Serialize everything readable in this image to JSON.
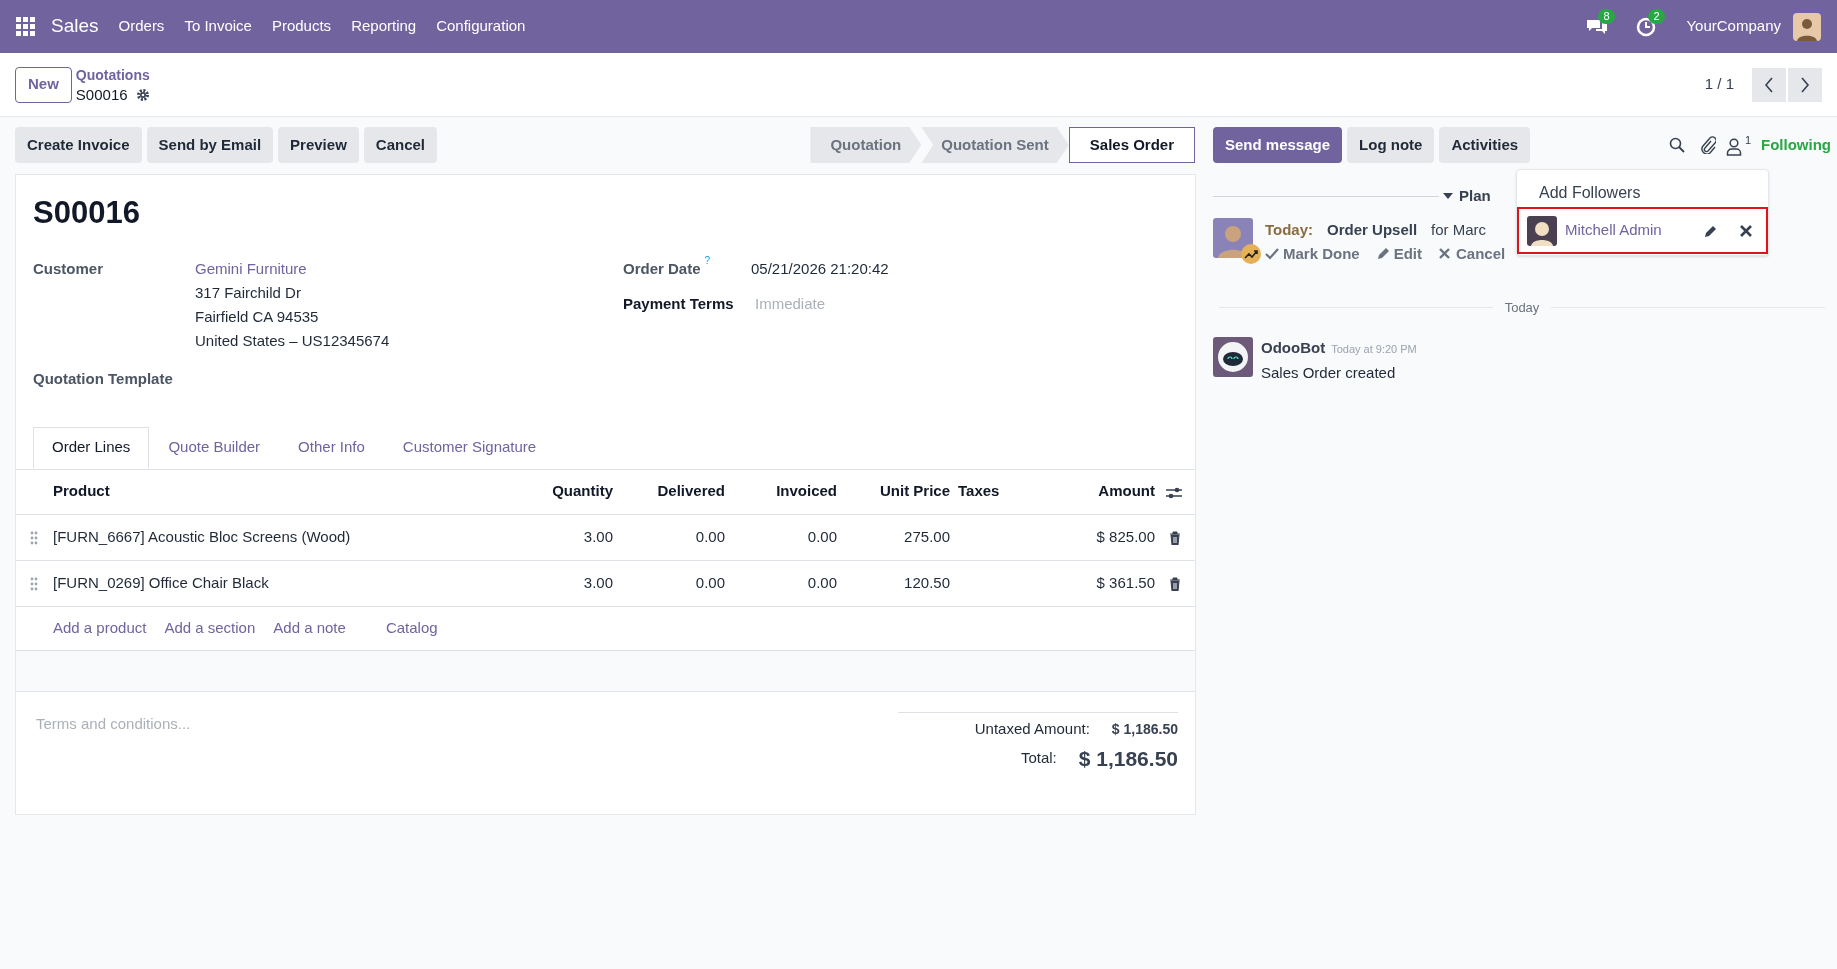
{
  "navbar": {
    "app": "Sales",
    "menu": [
      "Orders",
      "To Invoice",
      "Products",
      "Reporting",
      "Configuration"
    ],
    "messages_badge": "8",
    "activities_badge": "2",
    "company": "YourCompany"
  },
  "control_panel": {
    "new_button": "New",
    "breadcrumb": "Quotations",
    "record": "S00016",
    "pager": "1 / 1"
  },
  "actions": [
    "Create Invoice",
    "Send by Email",
    "Preview",
    "Cancel"
  ],
  "statusbar": [
    {
      "label": "Quotation",
      "selected": false
    },
    {
      "label": "Quotation Sent",
      "selected": false
    },
    {
      "label": "Sales Order",
      "selected": true
    }
  ],
  "form": {
    "title": "S00016",
    "customer": {
      "label": "Customer",
      "name": "Gemini Furniture",
      "address": [
        "317 Fairchild Dr",
        "Fairfield CA 94535",
        "United States – US12345674"
      ]
    },
    "quotation_template": {
      "label": "Quotation Template"
    },
    "order_date": {
      "label": "Order Date",
      "help": "?",
      "value": "05/21/2026 21:20:42"
    },
    "payment_terms": {
      "label": "Payment Terms",
      "placeholder": "Immediate"
    },
    "tabs": [
      {
        "label": "Order Lines",
        "selected": true
      },
      {
        "label": "Quote Builder",
        "selected": false
      },
      {
        "label": "Other Info",
        "selected": false
      },
      {
        "label": "Customer Signature",
        "selected": false
      }
    ],
    "table": {
      "columns": [
        "Product",
        "Quantity",
        "Delivered",
        "Invoiced",
        "Unit Price",
        "Taxes",
        "Amount"
      ],
      "rows": [
        [
          "[FURN_6667] Acoustic Bloc Screens (Wood)",
          "3.00",
          "0.00",
          "0.00",
          "275.00",
          "",
          "$ 825.00"
        ],
        [
          "[FURN_0269] Office Chair Black",
          "3.00",
          "0.00",
          "0.00",
          "120.50",
          "",
          "$ 361.50"
        ]
      ],
      "add_links": [
        "Add a product",
        "Add a section",
        "Add a note",
        "Catalog"
      ]
    },
    "terms_placeholder": "Terms and conditions...",
    "totals": [
      {
        "label": "Untaxed Amount:",
        "value": "$ 1,186.50",
        "kind": "subtotal"
      },
      {
        "label": "Total:",
        "value": "$ 1,186.50",
        "kind": "total"
      }
    ]
  },
  "chatter": {
    "buttons": [
      {
        "label": "Send message",
        "kind": "primary"
      },
      {
        "label": "Log note",
        "kind": "secondary"
      },
      {
        "label": "Activities",
        "kind": "secondary"
      }
    ],
    "followers_count": "1",
    "following": "Following",
    "activity_separator": "Plan",
    "activity": {
      "due": "Today:",
      "summary": "Order Upsell",
      "assignee": "for Marc",
      "actions": [
        "Mark Done",
        "Edit",
        "Cancel"
      ]
    },
    "date_separator": "Today",
    "messages": [
      {
        "author": "OdooBot",
        "time": "Today at 9:20 PM",
        "body": "Sales Order created"
      }
    ],
    "followers_dropdown": {
      "title": "Add Followers",
      "followers": [
        {
          "name": "Mitchell Admin",
          "highlighted": true
        }
      ]
    }
  }
}
